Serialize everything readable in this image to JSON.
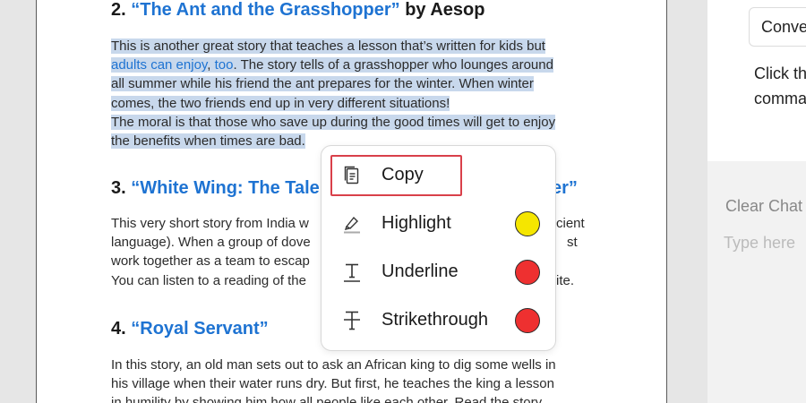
{
  "document": {
    "section2": {
      "number": "2.",
      "title": "“The Ant and the Grasshopper”",
      "by": " by Aesop",
      "para1_a": "This is another great story that teaches a lesson that’s written for kids but",
      "para1_b_link": "adults can enjoy",
      "para1_b_comma": ",",
      "para1_b_link2": "too",
      "para1_b_rest": ". The story tells of a grasshopper who lounges around",
      "para1_c": "all summer while his friend the ant prepares for the winter. When winter",
      "para1_d": "comes, the two friends end up in very different situations!",
      "para2_a": "The moral is that those who save up during the good times will get to enjoy",
      "para2_b": "the benefits when times are bad."
    },
    "section3": {
      "number": "3.",
      "title_left": "“White Wing: The Tale",
      "title_right": "er”",
      "line1_left": "This very short story from India w",
      "line1_right": "cient",
      "line2_left": "language). When a group of dove",
      "line2_right": "st",
      "line3_left": "work together as a team to escap",
      "line4_left": "You can listen to a reading of the",
      "line4_right": "ite."
    },
    "section4": {
      "number": "4.",
      "title": "“Royal Servant”",
      "line1": "In this story, an old man sets out to ask an African king to dig some wells in",
      "line2": "his village when their water runs dry. But first, he teaches the king a lesson",
      "line3": "in humility by showing him how all people like each other. Read the story"
    }
  },
  "context_menu": {
    "items": [
      {
        "label": "Copy",
        "icon": "copy-icon"
      },
      {
        "label": "Highlight",
        "icon": "highlighter-icon",
        "color": "#f5e600"
      },
      {
        "label": "Underline",
        "icon": "underline-icon",
        "color": "#ee3030"
      },
      {
        "label": "Strikethrough",
        "icon": "strikethrough-icon",
        "color": "#ee3030"
      }
    ]
  },
  "side_panel": {
    "convert_label": "Conve",
    "hint_line1": "Click th",
    "hint_line2": "comma",
    "clear_chat": "Clear Chat",
    "input_placeholder": "Type here"
  },
  "colors": {
    "link": "#1e73d2",
    "selection": "#c8d8ec",
    "copy_outline": "#d9404a"
  }
}
